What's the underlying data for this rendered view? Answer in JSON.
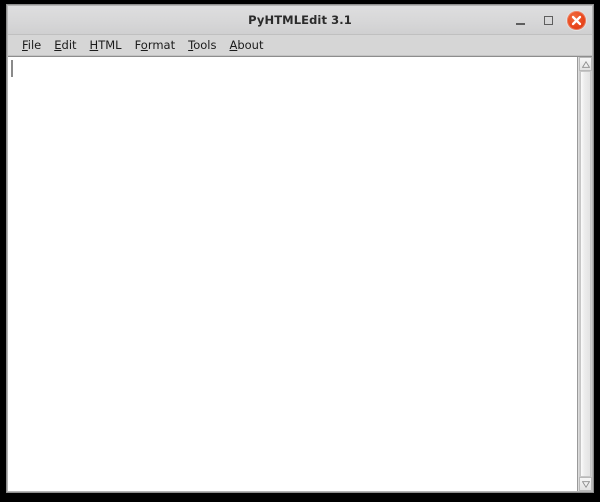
{
  "window": {
    "title": "PyHTMLEdit 3.1",
    "controls": {
      "minimize": "minimize-button",
      "maximize": "maximize-button",
      "close": "close-button"
    }
  },
  "menu": {
    "items": [
      {
        "label": "File",
        "mnemonic_index": 0,
        "pre": "",
        "key": "F",
        "post": "ile"
      },
      {
        "label": "Edit",
        "mnemonic_index": 0,
        "pre": "",
        "key": "E",
        "post": "dit"
      },
      {
        "label": "HTML",
        "mnemonic_index": 0,
        "pre": "",
        "key": "H",
        "post": "TML"
      },
      {
        "label": "Format",
        "mnemonic_index": 1,
        "pre": "F",
        "key": "o",
        "post": "rmat"
      },
      {
        "label": "Tools",
        "mnemonic_index": 0,
        "pre": "",
        "key": "T",
        "post": "ools"
      },
      {
        "label": "About",
        "mnemonic_index": 0,
        "pre": "",
        "key": "A",
        "post": "bout"
      }
    ]
  },
  "editor": {
    "content": "",
    "placeholder": "",
    "caret_visible": true
  },
  "scrollbar": {
    "orientation": "vertical",
    "up_arrow": "scroll-up-arrow",
    "down_arrow": "scroll-down-arrow",
    "thumb_position_percent": 0,
    "thumb_size_percent": 100
  },
  "colors": {
    "titlebar_bg": "#d7d7d8",
    "menubar_bg": "#d6d6d6",
    "close_accent": "#e8441a",
    "editor_bg": "#ffffff",
    "window_border": "#8f8f8f",
    "desktop_bg": "#000000"
  }
}
